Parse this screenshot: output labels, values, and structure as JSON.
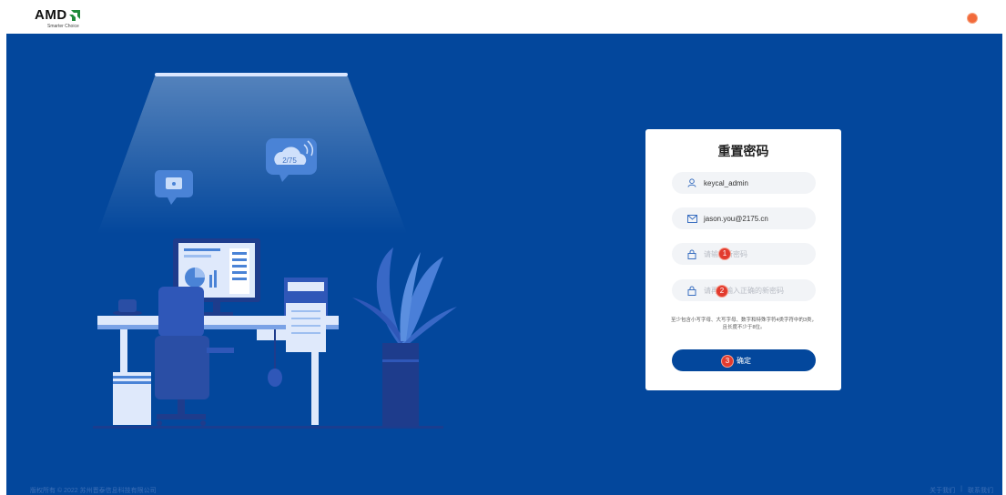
{
  "header": {
    "logo_text": "AMD",
    "logo_tagline": "Smarter Choice"
  },
  "form": {
    "title": "重置密码",
    "username": "keycal_admin",
    "email": "jason.you@2175.cn",
    "new_password_placeholder": "请输入新密码",
    "confirm_password_placeholder": "请再次输入正确的新密码",
    "hint": "至少包含小写字母、大写字母、数字和特殊字符4类字符中的3类，且长度不少于8位。",
    "submit_label": "确定",
    "markers": [
      "1",
      "2",
      "3"
    ]
  },
  "illustration": {
    "cloud_label": "2/75"
  },
  "footer": {
    "copyright": "版权所有 © 2022 苏州晋泰信息科技有限公司",
    "links": [
      "关于我们",
      "联系我们"
    ]
  },
  "colors": {
    "primary": "#03479c",
    "marker": "#e23b2e",
    "avatar": "#f26a3b"
  }
}
